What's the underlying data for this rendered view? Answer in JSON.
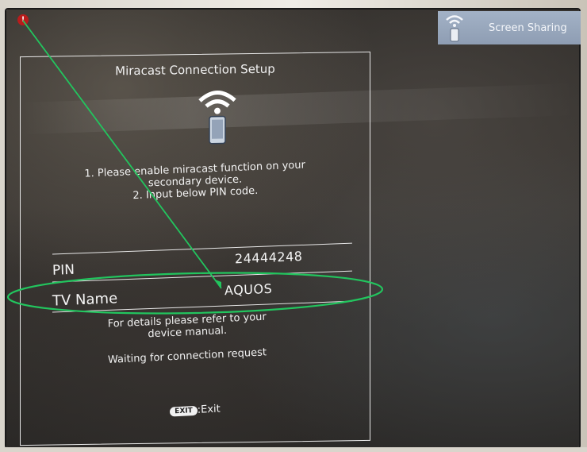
{
  "badge": {
    "label": "Screen Sharing"
  },
  "marker": {
    "label": "!"
  },
  "dialog": {
    "title": "Miracast Connection Setup",
    "instructions": [
      "1. Please enable miracast function on your",
      "secondary device.",
      "2. Input below PIN code."
    ],
    "pin_label": "PIN",
    "pin_value": "24444248",
    "tv_name_label": "TV Name",
    "tv_name_value": "AQUOS",
    "details": [
      "For details please refer to your",
      "device manual."
    ],
    "status": "Waiting for connection request",
    "exit_key": "EXIT",
    "exit_label": ":Exit"
  },
  "icons": {
    "badge_icon": "wifi-phone-icon",
    "main_icon": "wifi-phone-icon"
  },
  "colors": {
    "annotation_green": "#22c55e",
    "marker_red": "#b91c1c",
    "badge_bg": "#9aa9be"
  }
}
